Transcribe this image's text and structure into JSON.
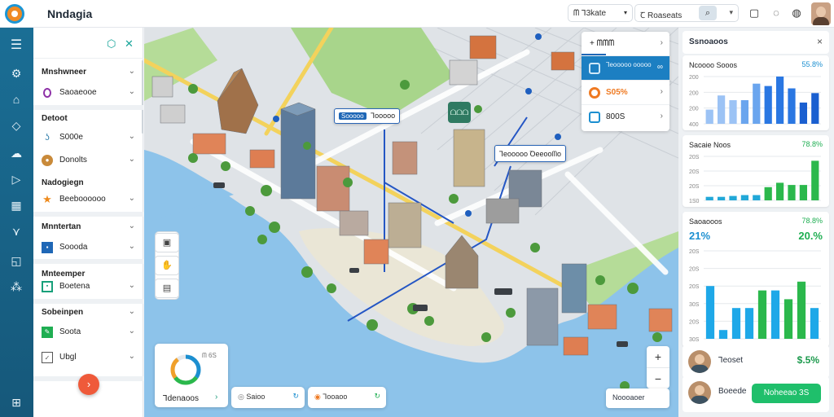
{
  "app": {
    "title": "Nndagia"
  },
  "topbar": {
    "filter_label": "ᗰ Ꞁ3kate",
    "search_label": "Ꞇ Roaseats",
    "icons": [
      "filter-icon",
      "search-icon",
      "chevron-down-icon",
      "bookmark-icon",
      "chat-icon",
      "check-circle-icon",
      "avatar"
    ]
  },
  "rail": {
    "icons": [
      "menu-icon",
      "settings-icon",
      "home-icon",
      "tag-icon",
      "cloud-icon",
      "folder-icon",
      "chart-icon",
      "route-icon",
      "export-icon",
      "network-icon",
      "grid-icon"
    ]
  },
  "left_panel": {
    "sections": [
      {
        "label": "Mnshwneer",
        "items": [
          {
            "label": "Saoaeooe",
            "icon": "ring-icon",
            "color": "#8d2fa6"
          }
        ]
      },
      {
        "label": "Detoot",
        "items": [
          {
            "label": "S000e",
            "icon": "hook-icon",
            "color": "#2a7aa8"
          },
          {
            "label": "Donolts",
            "icon": "coin-icon",
            "color": "#c98a3a"
          }
        ]
      },
      {
        "label": "Nadogiegn",
        "items": [
          {
            "label": "Beeboooooo",
            "icon": "star-icon",
            "color": "#ee8a1c"
          }
        ]
      },
      {
        "label": "Mnntertan",
        "items": [
          {
            "label": "Soooda",
            "icon": "flag-icon",
            "color": "#1f67b6"
          }
        ]
      },
      {
        "label": "Mnteemper",
        "items": [
          {
            "label": "Boetena",
            "icon": "square-icon",
            "color": "#17a07a"
          }
        ]
      },
      {
        "label": "Sobeinpen",
        "items": [
          {
            "label": "Soota",
            "icon": "edit-icon",
            "color": "#1fae52"
          },
          {
            "label": "Ubgl",
            "icon": "doc-icon",
            "color": "#555555"
          }
        ]
      }
    ],
    "fab_label": "›"
  },
  "map": {
    "labels": [
      {
        "tag": "Sooooo",
        "text": "Ꞁooooo"
      },
      {
        "tag": "",
        "text": "Ꞁeooooo Ꝺeeooᗰo"
      }
    ],
    "marker_label": "ᗝᗝᗝ",
    "layers": [
      {
        "label": "+ ᗰᗰᗰ",
        "right": "›"
      },
      {
        "label": "Ꞁeooooo ooooo",
        "right": "∞",
        "active": true
      },
      {
        "label": "S05%",
        "right": "›",
        "color": "#ef7a22"
      },
      {
        "label": "800S",
        "right": "›",
        "color": "#1c8fd0"
      }
    ],
    "donut": {
      "label": "Ꞁdenaoos",
      "pct": "ᗰ 6S"
    },
    "pills": [
      "Saioo",
      "Ꞁooaoo"
    ],
    "scale_label": "Noooaoer",
    "zoom_in": "+",
    "zoom_out": "−"
  },
  "right_panel": {
    "title": "Ssnoaoos",
    "close": "×",
    "cards": [
      {
        "title": "Ncoooo Sooos",
        "value": "55.8%",
        "value_color": "#1c8fd0",
        "chart": {
          "type": "bar",
          "color": "#1e6fe0",
          "ticks": [
            "200",
            "200",
            "200",
            "400"
          ]
        }
      },
      {
        "title": "Sacaie Noos",
        "value": "78.8%",
        "value_color": "#1fae52",
        "chart": {
          "type": "bar",
          "color": "#2bb84c",
          "ticks": [
            "20S",
            "20S",
            "20S",
            "1S0"
          ]
        }
      },
      {
        "title": "Saoaooos",
        "value": "78.8%",
        "value_color": "#1fae52",
        "big_left": "21%",
        "big_right": "20.%",
        "chart": {
          "type": "bar",
          "ticks": [
            "20S",
            "20S",
            "20S",
            "30S",
            "20S",
            "30S"
          ]
        }
      }
    ],
    "people": [
      {
        "name": "Ꞁeoset",
        "value": "$.5%"
      },
      {
        "name": "Boeede",
        "cta": "Noheeao 3S"
      }
    ]
  },
  "chart_data": [
    {
      "type": "bar",
      "title": "Ncoooo Sooos",
      "series": [
        {
          "values": [
            0.3,
            0.6,
            0.5,
            0.5,
            0.85,
            0.8,
            1.0,
            0.75,
            0.45,
            0.65
          ]
        }
      ]
    },
    {
      "type": "bar",
      "title": "Sacaie Noos",
      "series": [
        {
          "values": [
            0.08,
            0.08,
            0.1,
            0.12,
            0.12,
            0.3,
            0.4,
            0.35,
            0.35,
            0.9
          ]
        }
      ]
    },
    {
      "type": "bar",
      "title": "Saoaooos",
      "series": [
        {
          "values": [
            0.6,
            0.1,
            0.35,
            0.35,
            0.55,
            0.35
          ]
        },
        {
          "values": [
            0.55,
            0.45,
            0.65
          ]
        }
      ]
    }
  ]
}
